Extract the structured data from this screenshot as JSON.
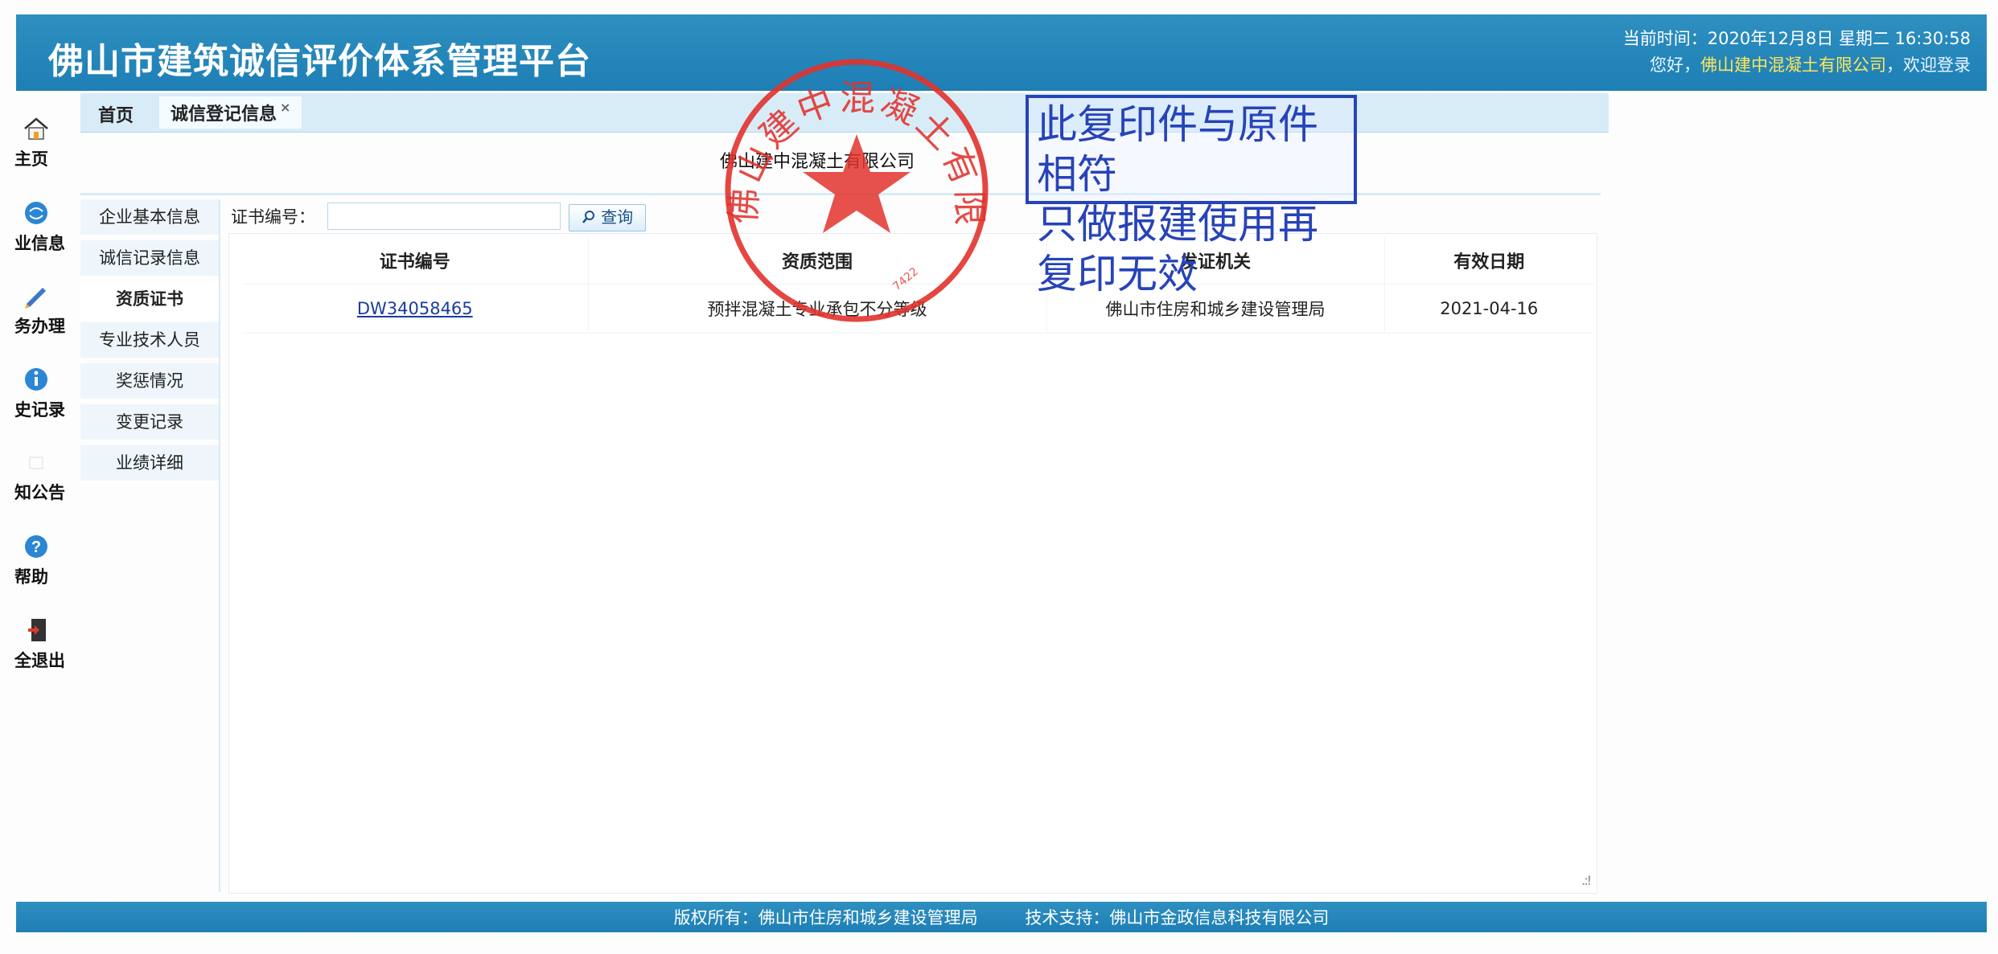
{
  "header": {
    "app_title": "佛山市建筑诚信评价体系管理平台",
    "current_time_label": "当前时间：2020年12月8日 星期二 16:30:58",
    "welcome_prefix": "您好，",
    "welcome_company": "佛山建中混凝土有限公司",
    "welcome_suffix": "，欢迎登录"
  },
  "icon_nav": [
    {
      "label": "主页",
      "icon": "home-icon"
    },
    {
      "label": "业信息",
      "icon": "globe-icon"
    },
    {
      "label": "务办理",
      "icon": "pencil-icon"
    },
    {
      "label": "史记录",
      "icon": "info-icon"
    },
    {
      "label": "知公告",
      "icon": "notice-icon"
    },
    {
      "label": "帮助",
      "icon": "help-icon"
    },
    {
      "label": "全退出",
      "icon": "exit-door-icon"
    }
  ],
  "tabs": [
    {
      "label": "首页"
    },
    {
      "label": "诚信登记信息",
      "close": "×"
    }
  ],
  "company_name": "佛山建中混凝土有限公司",
  "side_menu": [
    {
      "label": "企业基本信息"
    },
    {
      "label": "诚信记录信息"
    },
    {
      "label": "资质证书",
      "active": true
    },
    {
      "label": "专业技术人员"
    },
    {
      "label": "奖惩情况"
    },
    {
      "label": "变更记录"
    },
    {
      "label": "业绩详细"
    }
  ],
  "search": {
    "label": "证书编号：",
    "value": "",
    "button_label": "查询"
  },
  "table": {
    "columns": [
      "证书编号",
      "资质范围",
      "发证机关",
      "有效日期"
    ],
    "rows": [
      [
        "DW34058465",
        "预拌混凝土专业承包不分等级",
        "佛山市住房和城乡建设管理局",
        "2021-04-16"
      ]
    ]
  },
  "footer": {
    "copyright": "版权所有：佛山市住房和城乡建设管理局",
    "support": "技术支持：佛山市金政信息科技有限公司"
  },
  "seal": {
    "ring_text": "佛山建中混凝土有限公司",
    "code": "7422",
    "color": "#e2322c"
  },
  "copy_stamp": {
    "line1": "此复印件与原件相符",
    "line2": "只做报建使用再复印无效",
    "color": "#2743b8"
  },
  "colors": {
    "header_bg": "#1e7fb5",
    "tab_bar_bg": "#d7ecf7",
    "link": "#1a3d9c"
  }
}
